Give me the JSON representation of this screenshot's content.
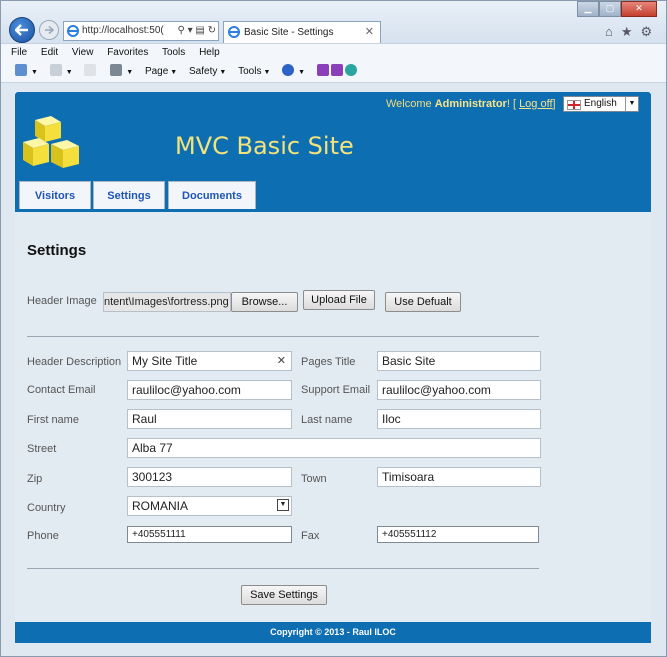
{
  "browser": {
    "address": "http://localhost:50(",
    "tab_title": "Basic Site - Settings",
    "menu": [
      "File",
      "Edit",
      "View",
      "Favorites",
      "Tools",
      "Help"
    ],
    "commands": [
      "Page",
      "Safety",
      "Tools"
    ]
  },
  "header": {
    "site_title": "MVC Basic Site",
    "welcome_prefix": "Welcome ",
    "user": "Administrator",
    "welcome_sep": "! [ ",
    "logoff": "Log off",
    "welcome_end": "]",
    "language": "English",
    "tabs": [
      "Visitors",
      "Settings",
      "Documents"
    ]
  },
  "form": {
    "heading": "Settings",
    "header_image": {
      "label": "Header Image",
      "file": "ntent\\Images\\fortress.png",
      "browse": "Browse...",
      "upload": "Upload File",
      "default": "Use Defualt"
    },
    "header_description": {
      "label": "Header Description",
      "value": "My Site Title"
    },
    "pages_title": {
      "label": "Pages Title",
      "value": "Basic Site"
    },
    "contact_email": {
      "label": "Contact Email",
      "value": "rauliloc@yahoo.com"
    },
    "support_email": {
      "label": "Support Email",
      "value": "rauliloc@yahoo.com"
    },
    "first_name": {
      "label": "First name",
      "value": "Raul"
    },
    "last_name": {
      "label": "Last name",
      "value": "Iloc"
    },
    "street": {
      "label": "Street",
      "value": "Alba 77"
    },
    "zip": {
      "label": "Zip",
      "value": "300123"
    },
    "town": {
      "label": "Town",
      "value": "Timisoara"
    },
    "country": {
      "label": "Country",
      "value": "ROMANIA"
    },
    "phone": {
      "label": "Phone",
      "value": "+405551111"
    },
    "fax": {
      "label": "Fax",
      "value": "+405551112"
    },
    "save": "Save Settings"
  },
  "footer": {
    "copyright": "Copyright © 2013 - Raul ILOC"
  },
  "colors": {
    "header_blue": "#0e6eb2",
    "title_yellow": "#f3e37a",
    "content_bg": "#e3ebf2",
    "tab_text": "#1f55b8"
  }
}
